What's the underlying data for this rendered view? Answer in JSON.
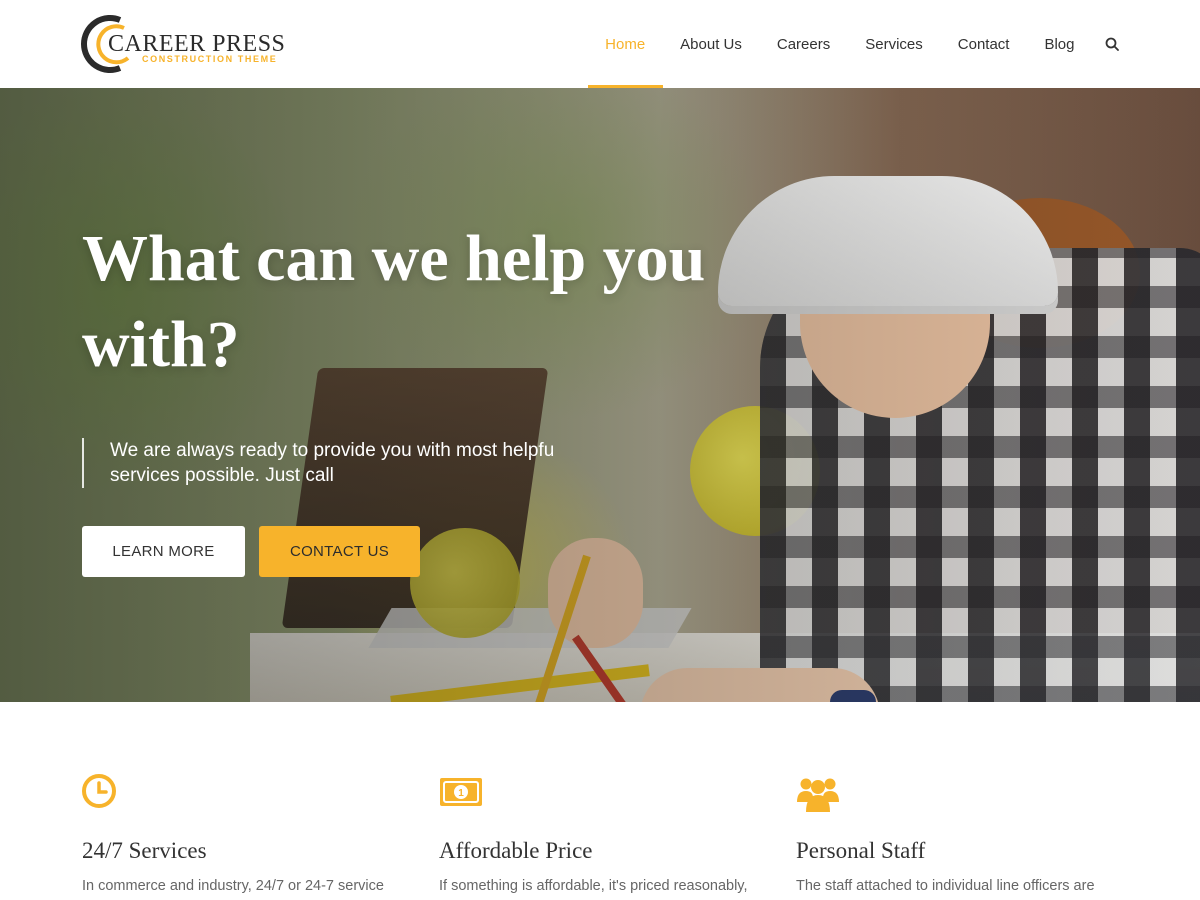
{
  "logo": {
    "title": "CAREER PRESS",
    "subtitle": "CONSTRUCTION THEME"
  },
  "nav": {
    "items": [
      {
        "label": "Home",
        "active": true
      },
      {
        "label": "About Us",
        "active": false
      },
      {
        "label": "Careers",
        "active": false
      },
      {
        "label": "Services",
        "active": false
      },
      {
        "label": "Contact",
        "active": false
      },
      {
        "label": "Blog",
        "active": false
      }
    ],
    "search_icon": "search-icon"
  },
  "hero": {
    "title": "What can we help you with?",
    "quote": "We are always ready to provide you with most helpfu services possible. Just call",
    "learn_more": "LEARN MORE",
    "contact_us": "CONTACT US"
  },
  "features": [
    {
      "icon": "clock-icon",
      "title": "24/7 Services",
      "text": "In commerce and industry, 24/7 or 24-7 service"
    },
    {
      "icon": "money-icon",
      "title": "Affordable Price",
      "text": "If something is affordable, it's priced reasonably,"
    },
    {
      "icon": "group-icon",
      "title": "Personal Staff",
      "text": "The staff attached to individual line officers are"
    }
  ],
  "colors": {
    "accent": "#f7b32b",
    "text": "#333333",
    "muted": "#666666"
  }
}
